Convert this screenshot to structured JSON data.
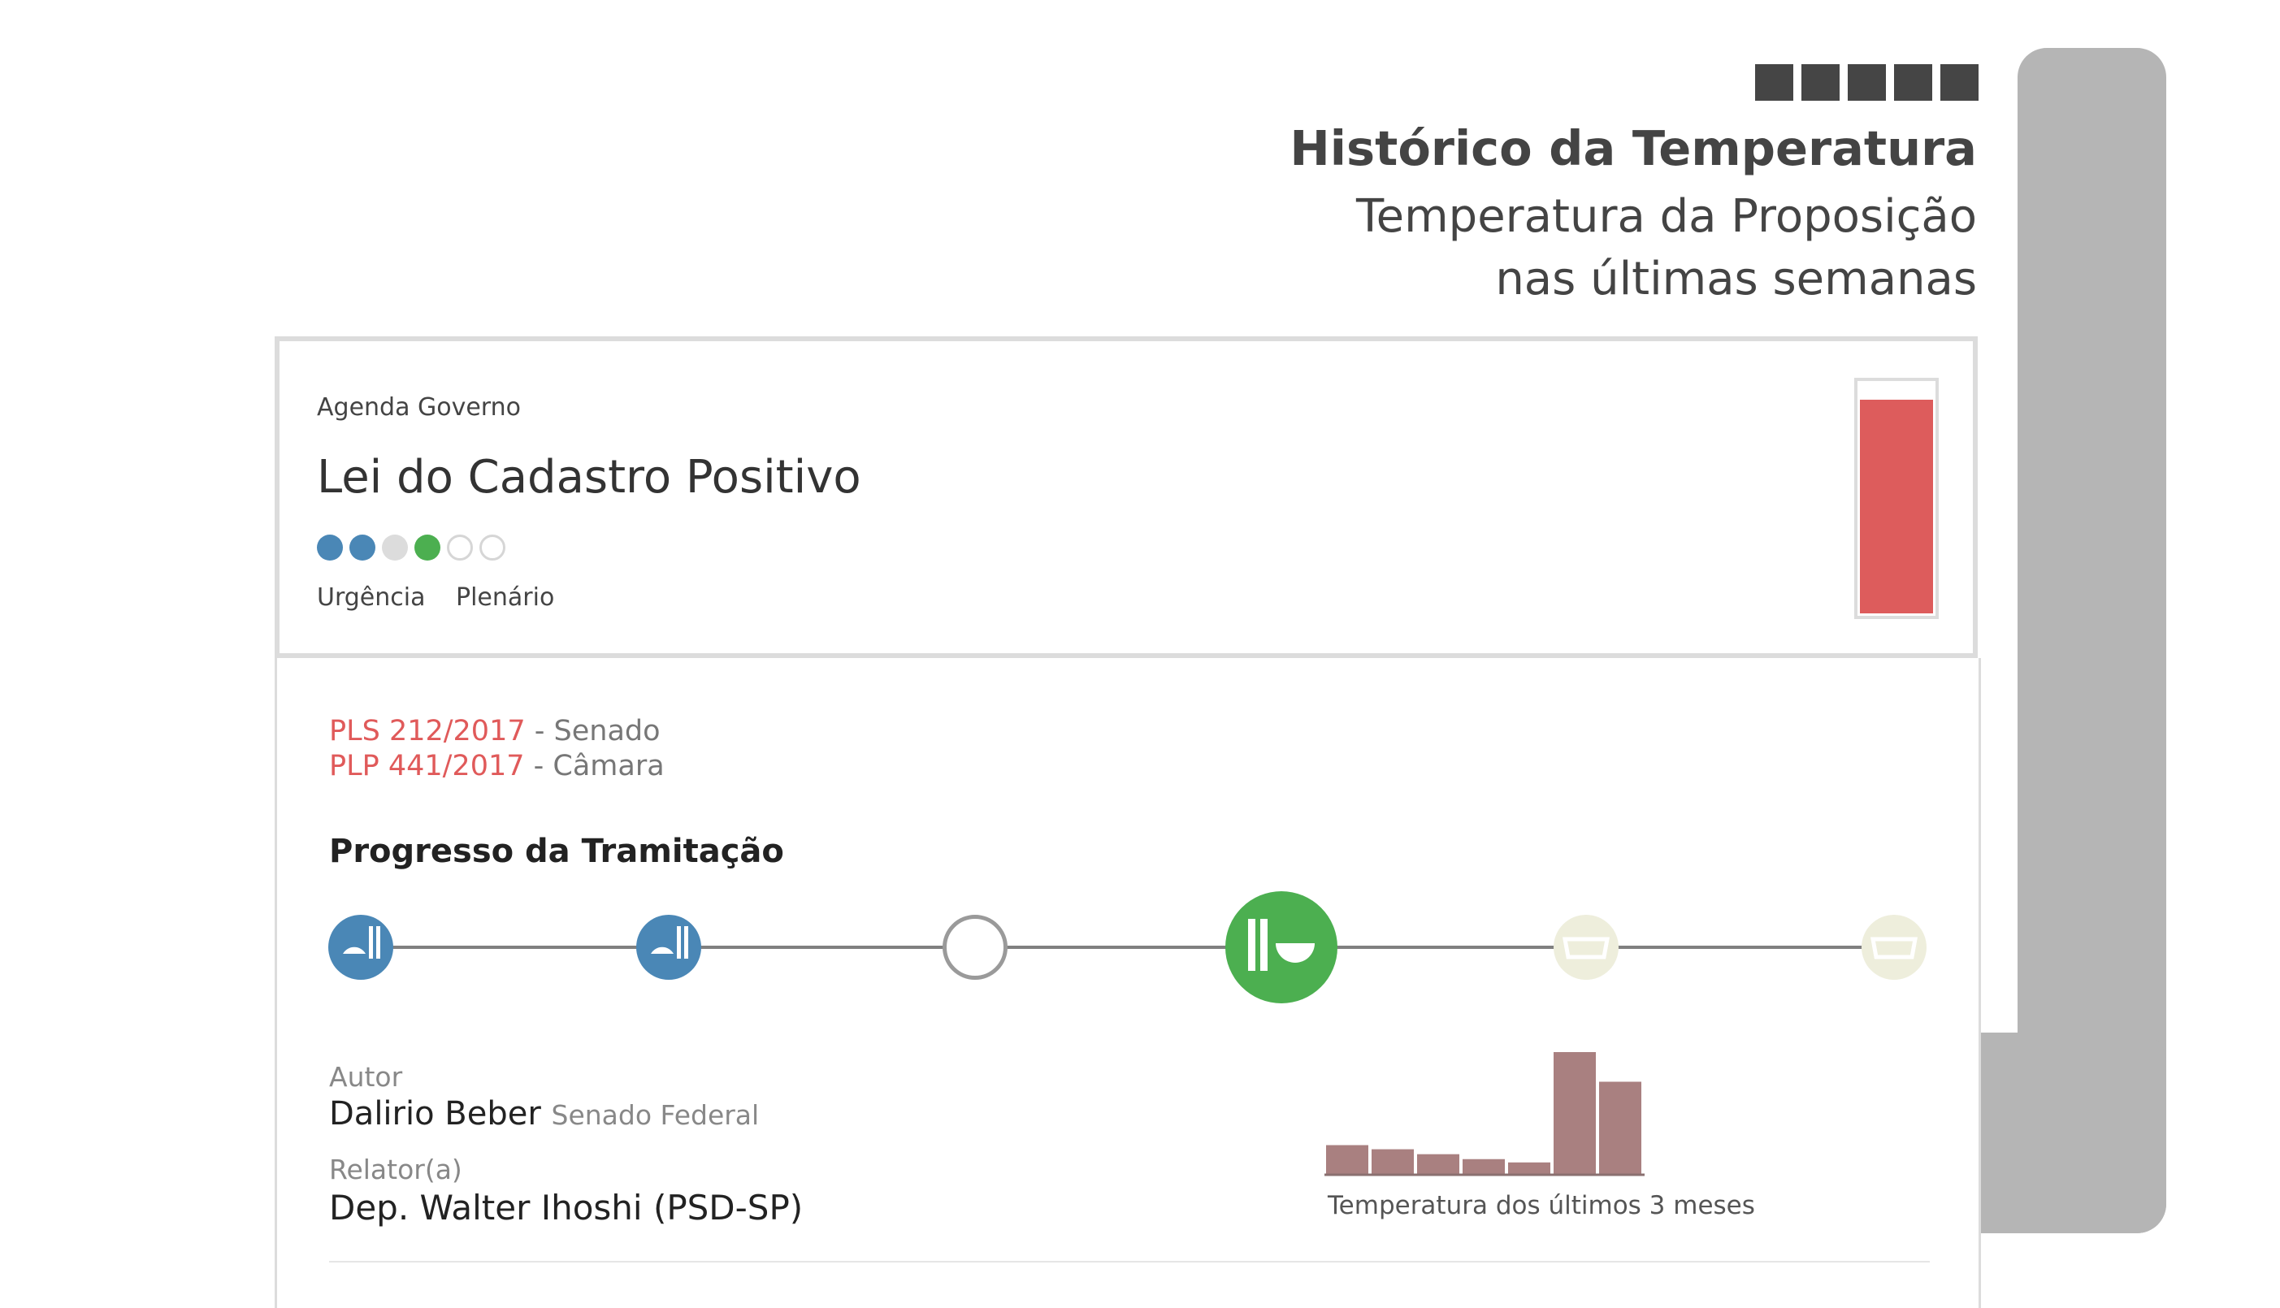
{
  "header": {
    "title": "Histórico da Temperatura",
    "subtitle_line1": "Temperatura da Proposição",
    "subtitle_line2": "nas últimas semanas",
    "indicator_count": 5
  },
  "card": {
    "agenda": "Agenda Governo",
    "title": "Lei do Cadastro Positivo",
    "progress_dots": [
      "blue",
      "blue",
      "grey",
      "green",
      "empty",
      "empty"
    ],
    "label_urgencia": "Urgência",
    "label_plenario": "Plenário",
    "temperature_level": 0.93,
    "thermo_color": "#dd5c5c"
  },
  "propositions": [
    {
      "code": "PLS 212/2017",
      "house": " - Senado"
    },
    {
      "code": "PLP 441/2017",
      "house": " - Câmara"
    }
  ],
  "progress": {
    "title": "Progresso da Tramitação",
    "steps": [
      {
        "name": "senado-step-1",
        "state": "done"
      },
      {
        "name": "senado-step-2",
        "state": "done"
      },
      {
        "name": "step-3",
        "state": "pending"
      },
      {
        "name": "plenario-step",
        "state": "current"
      },
      {
        "name": "step-5",
        "state": "future"
      },
      {
        "name": "step-6",
        "state": "future"
      }
    ]
  },
  "people": {
    "author_label": "Autor",
    "author_name": "Dalirio Beber",
    "author_org": "Senado Federal",
    "rapporteur_label": "Relator(a)",
    "rapporteur_name": "Dep. Walter Ihoshi (PSD-SP)"
  },
  "chart_data": {
    "type": "bar",
    "caption": "Temperatura dos últimos 3 meses",
    "values": [
      35,
      30,
      24,
      18,
      14,
      148,
      112
    ],
    "color": "#a98080"
  }
}
